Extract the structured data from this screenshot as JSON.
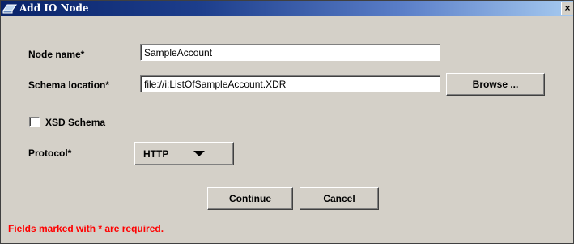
{
  "window": {
    "title": "Add IO Node",
    "close_glyph": "×",
    "icon": "window-icon"
  },
  "form": {
    "node_name": {
      "label": "Node name*",
      "value": "SampleAccount"
    },
    "schema_location": {
      "label": "Schema location*",
      "value": "file://i:ListOfSampleAccount.XDR",
      "browse_label": "Browse ..."
    },
    "xsd_schema": {
      "label": "XSD Schema",
      "checked": false
    },
    "protocol": {
      "label": "Protocol*",
      "selected": "HTTP"
    }
  },
  "actions": {
    "continue_label": "Continue",
    "cancel_label": "Cancel"
  },
  "footer": {
    "required_note": "Fields marked with * are required.",
    "note_color": "#ff0000"
  },
  "colors": {
    "title_bar": "#0a246a",
    "dialog_bg": "#d4d0c8"
  }
}
